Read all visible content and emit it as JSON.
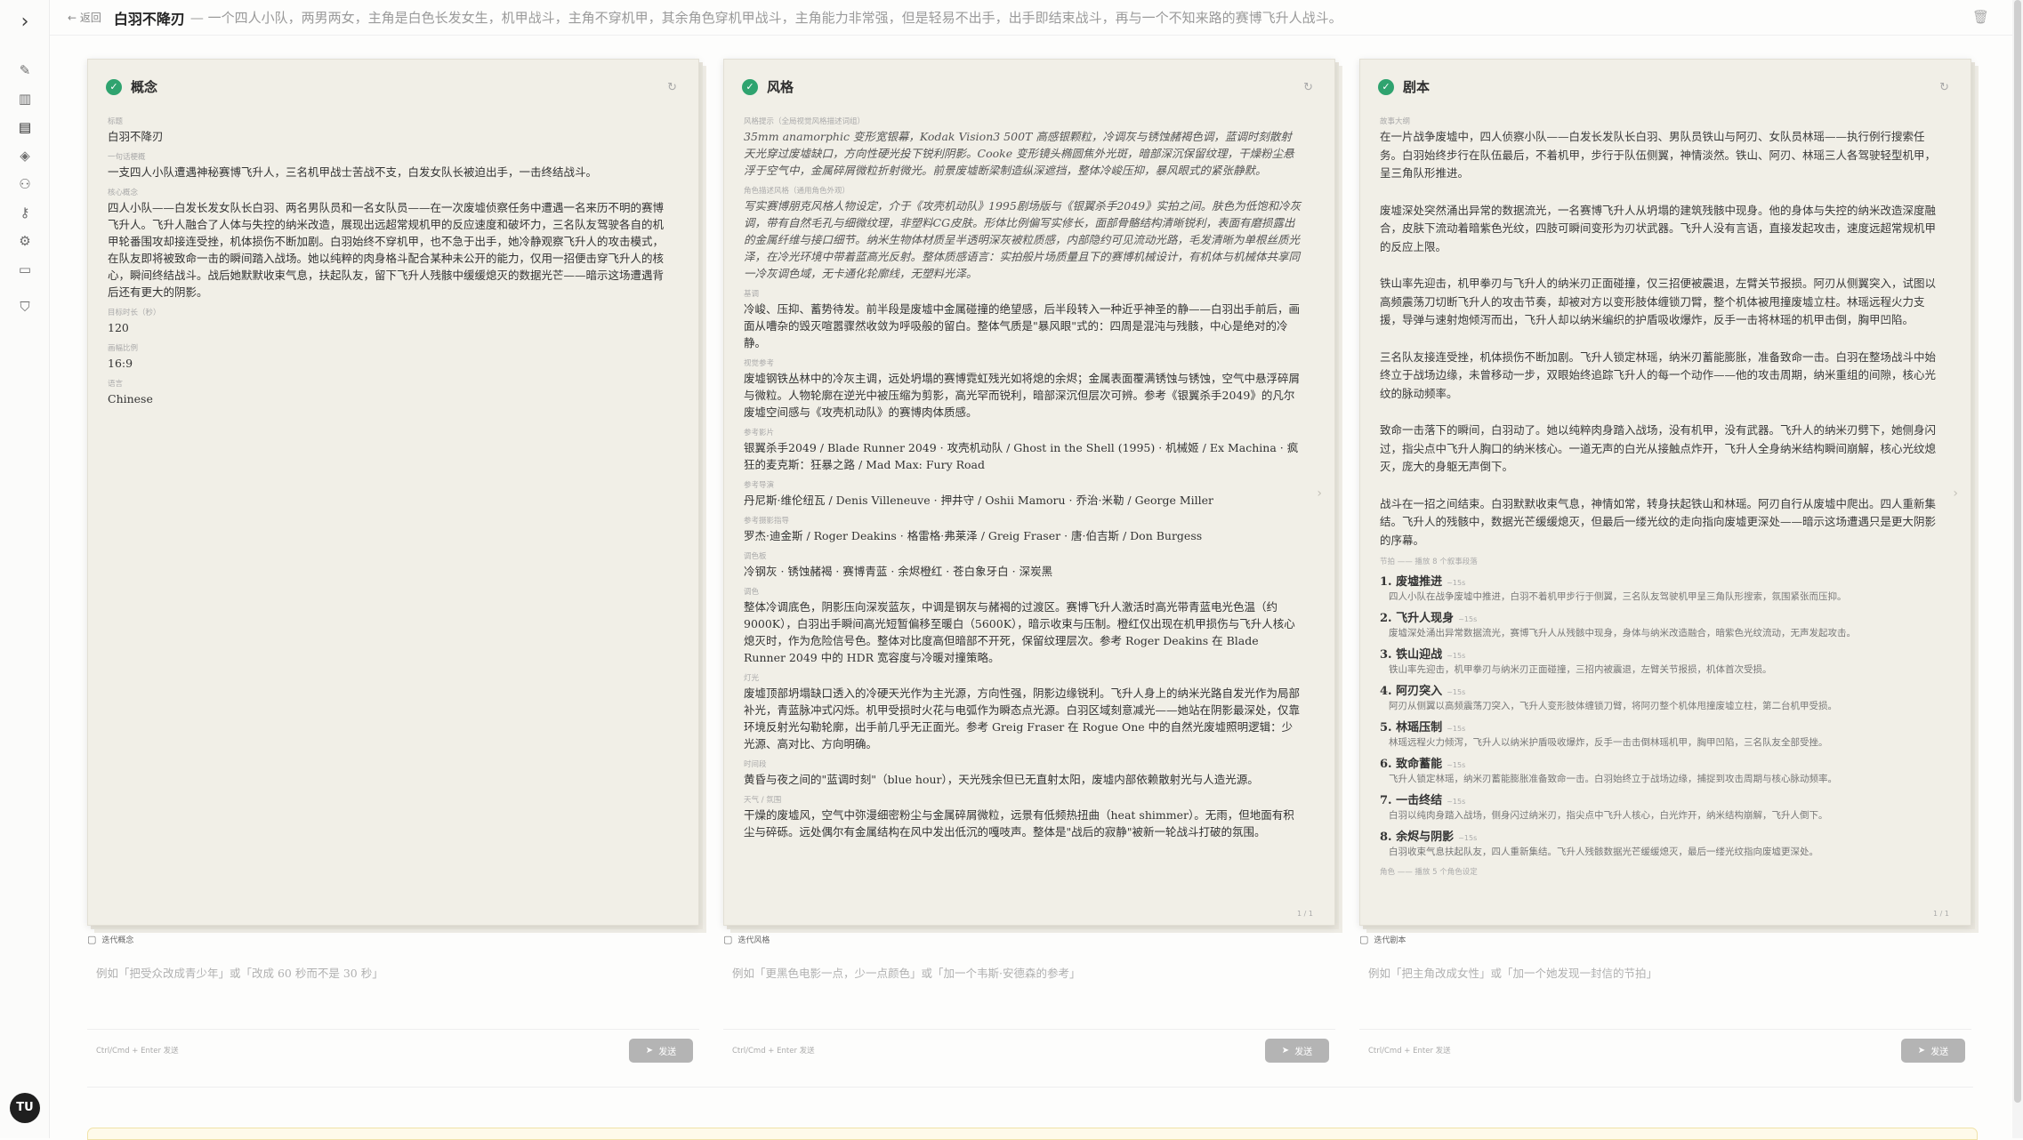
{
  "header": {
    "back_label": "← 返回",
    "title": "白羽不降刃",
    "premise": "— 一个四人小队，两男两女，主角是白色长发女生，机甲战斗，主角不穿机甲，其余角色穿机甲战斗，主角能力非常强，但是轻易不出手，出手即结束战斗，再与一个不知来路的赛博飞升人战斗。"
  },
  "avatar": "TU",
  "cards": {
    "concept": {
      "title": "概念",
      "fields": [
        {
          "label": "标题",
          "value": "白羽不降刃"
        },
        {
          "label": "一句话梗概",
          "value": "一支四人小队遭遇神秘赛博飞升人，三名机甲战士苦战不支，白发女队长被迫出手，一击终结战斗。"
        },
        {
          "label": "核心概念",
          "value": "四人小队——白发长发女队长白羽、两名男队员和一名女队员——在一次废墟侦察任务中遭遇一名来历不明的赛博飞升人。飞升人融合了人体与失控的纳米改造，展现出远超常规机甲的反应速度和破坏力，三名队友驾驶各自的机甲轮番围攻却接连受挫，机体损伤不断加剧。白羽始终不穿机甲，也不急于出手，她冷静观察飞升人的攻击模式，在队友即将被致命一击的瞬间踏入战场。她以纯粹的肉身格斗配合某种未公开的能力，仅用一招便击穿飞升人的核心，瞬间终结战斗。战后她默默收束气息，扶起队友，留下飞升人残骸中缓缓熄灭的数据光芒——暗示这场遭遇背后还有更大的阴影。"
        },
        {
          "label": "目标时长（秒）",
          "value": "120"
        },
        {
          "label": "画幅比例",
          "value": "16:9"
        },
        {
          "label": "语言",
          "value": "Chinese"
        }
      ]
    },
    "style": {
      "title": "风格",
      "fields": [
        {
          "label": "风格提示（全局视觉风格描述词组）",
          "value": "35mm anamorphic 变形宽银幕，Kodak Vision3 500T 高感银颗粒，冷调灰与锈蚀赭褐色调，蓝调时刻散射天光穿过废墟缺口，方向性硬光投下锐利阴影。Cooke 变形镜头椭圆焦外光斑，暗部深沉保留纹理，干燥粉尘悬浮于空气中，金属碎屑微粒折射微光。前景废墟断梁制造纵深遮挡，整体冷峻压抑，暴风眼式的紧张静默。",
          "italic": true
        },
        {
          "label": "角色描述风格（通用角色外观）",
          "value": "写实赛博朋克风格人物设定，介于《攻壳机动队》1995剧场版与《银翼杀手2049》实拍之间。肤色为低饱和冷灰调，带有自然毛孔与细微纹理，非塑料CG皮肤。形体比例偏写实修长，面部骨骼结构清晰锐利，表面有磨损露出的金属纤维与接口细节。纳米生物体材质呈半透明深灰被粒质感，内部隐约可见流动光路，毛发清晰为单根丝质光泽，在冷光环境中带着蓝高光反射。整体质感语言：实拍般片场质量且下的赛博机械设计，有机体与机械体共享同一冷灰调色域，无卡通化轮廓线，无塑料光泽。",
          "italic": true
        },
        {
          "label": "基调",
          "value": "冷峻、压抑、蓄势待发。前半段是废墟中金属碰撞的绝望感，后半段转入一种近乎神圣的静——白羽出手前后，画面从嘈杂的毁灭喧嚣骤然收敛为呼吸般的留白。整体气质是\"暴风眼\"式的：四周是混沌与残骸，中心是绝对的冷静。"
        },
        {
          "label": "视觉参考",
          "value": "废墟钢铁丛林中的冷灰主调，远处坍塌的赛博霓虹残光如将熄的余烬；金属表面覆满锈蚀与锈蚀，空气中悬浮碎屑与微粒。人物轮廓在逆光中被压缩为剪影，高光罕而锐利，暗部深沉但层次可辨。参考《银翼杀手2049》的凡尔废墟空间感与《攻壳机动队》的赛博肉体质感。"
        },
        {
          "label": "参考影片",
          "value": "银翼杀手2049 / Blade Runner 2049 · 攻壳机动队 / Ghost in the Shell (1995) · 机械姬 / Ex Machina · 疯狂的麦克斯：狂暴之路 / Mad Max: Fury Road"
        },
        {
          "label": "参考导演",
          "value": "丹尼斯·维伦纽瓦 / Denis Villeneuve · 押井守 / Oshii Mamoru · 乔治·米勒 / George Miller"
        },
        {
          "label": "参考摄影指导",
          "value": "罗杰·迪金斯 / Roger Deakins · 格雷格·弗莱泽 / Greig Fraser · 唐·伯吉斯 / Don Burgess"
        },
        {
          "label": "调色板",
          "value": "冷钢灰 · 锈蚀赭褐 · 赛博青蓝 · 余烬橙红 · 苍白象牙白 · 深炭黑"
        },
        {
          "label": "调色",
          "value": "整体冷调底色，阴影压向深炭蓝灰，中调是钢灰与赭褐的过渡区。赛博飞升人激活时高光带青蓝电光色温（约9000K），白羽出手瞬间高光短暂偏移至暖白（5600K），暗示收束与压制。橙红仅出现在机甲损伤与飞升人核心熄灭时，作为危险信号色。整体对比度高但暗部不开死，保留纹理层次。参考 Roger Deakins 在 Blade Runner 2049 中的 HDR 宽容度与冷暖对撞策略。"
        },
        {
          "label": "灯光",
          "value": "废墟顶部坍塌缺口透入的冷硬天光作为主光源，方向性强，阴影边缘锐利。飞升人身上的纳米光路自发光作为局部补光，青蓝脉冲式闪烁。机甲受损时火花与电弧作为瞬态点光源。白羽区域刻意减光——她站在阴影最深处，仅靠环境反射光勾勒轮廓，出手前几乎无正面光。参考 Greig Fraser 在 Rogue One 中的自然光废墟照明逻辑：少光源、高对比、方向明确。"
        },
        {
          "label": "时间段",
          "value": "黄昏与夜之间的\"蓝调时刻\"（blue hour），天光残余但已无直射太阳，废墟内部依赖散射光与人造光源。"
        },
        {
          "label": "天气 / 氛围",
          "value": "干燥的废墟风，空气中弥漫细密粉尘与金属碎屑微粒，远景有低频热扭曲（heat shimmer）。无雨，但地面有积尘与碎砾。远处偶尔有金属结构在风中发出低沉的嘎吱声。整体是\"战后的寂静\"被新一轮战斗打破的氛围。"
        }
      ]
    },
    "script": {
      "title": "剧本",
      "label": "故事大纲",
      "paragraphs": [
        "在一片战争废墟中，四人侦察小队——白发长发队长白羽、男队员铁山与阿刃、女队员林瑶——执行例行搜索任务。白羽始终步行在队伍最后，不着机甲，步行于队伍侧翼，神情淡然。铁山、阿刃、林瑶三人各驾驶轻型机甲，呈三角队形推进。",
        "废墟深处突然涌出异常的数据流光，一名赛博飞升人从坍塌的建筑残骸中现身。他的身体与失控的纳米改造深度融合，皮肤下流动着暗紫色光纹，四肢可瞬间变形为刃状武器。飞升人没有言语，直接发起攻击，速度远超常规机甲的反应上限。",
        "铁山率先迎击，机甲拳刃与飞升人的纳米刃正面碰撞，仅三招便被震退，左臂关节报损。阿刃从侧翼突入，试图以高频震荡刀切断飞升人的攻击节奏，却被对方以变形肢体缠锁刀臂，整个机体被甩撞废墟立柱。林瑶远程火力支援，导弹与速射炮倾泻而出，飞升人却以纳米编织的护盾吸收爆炸，反手一击将林瑶的机甲击倒，胸甲凹陷。",
        "三名队友接连受挫，机体损伤不断加剧。飞升人锁定林瑶，纳米刃蓄能膨胀，准备致命一击。白羽在整场战斗中始终立于战场边缘，未曾移动一步，双眼始终追踪飞升人的每一个动作——他的攻击周期，纳米重组的间隙，核心光纹的脉动频率。",
        "致命一击落下的瞬间，白羽动了。她以纯粹肉身踏入战场，没有机甲，没有武器。飞升人的纳米刃劈下，她侧身闪过，指尖点中飞升人胸口的纳米核心。一道无声的白光从接触点炸开，飞升人全身纳米结构瞬间崩解，核心光纹熄灭，庞大的身躯无声倒下。",
        "战斗在一招之间结束。白羽默默收束气息，神情如常，转身扶起铁山和林瑶。阿刃自行从废墟中爬出。四人重新集结。飞升人的残骸中，数据光芒缓缓熄灭，但最后一缕光纹的走向指向废墟更深处——暗示这场遭遇只是更大阴影的序幕。"
      ],
      "beats_label": "节拍 —— 播放 8 个叙事段落",
      "beats": [
        {
          "title": "1. 废墟推进",
          "sec": "~15s",
          "desc": "四人小队在战争废墟中推进，白羽不着机甲步行于侧翼，三名队友驾驶机甲呈三角队形搜索，氛围紧张而压抑。"
        },
        {
          "title": "2. 飞升人现身",
          "sec": "~15s",
          "desc": "废墟深处涌出异常数据流光，赛博飞升人从残骸中现身，身体与纳米改造融合，暗紫色光纹流动，无声发起攻击。"
        },
        {
          "title": "3. 铁山迎战",
          "sec": "~15s",
          "desc": "铁山率先迎击，机甲拳刃与纳米刃正面碰撞，三招内被震退，左臂关节报损，机体首次受损。"
        },
        {
          "title": "4. 阿刃突入",
          "sec": "~15s",
          "desc": "阿刃从侧翼以高频震荡刀突入，飞升人变形肢体缠锁刀臂，将阿刃整个机体甩撞废墟立柱，第二台机甲受损。"
        },
        {
          "title": "5. 林瑶压制",
          "sec": "~15s",
          "desc": "林瑶远程火力倾泻，飞升人以纳米护盾吸收爆炸，反手一击击倒林瑶机甲，胸甲凹陷，三名队友全部受挫。"
        },
        {
          "title": "6. 致命蓄能",
          "sec": "~15s",
          "desc": "飞升人锁定林瑶，纳米刃蓄能膨胀准备致命一击。白羽始终立于战场边缘，捕捉到攻击周期与核心脉动频率。"
        },
        {
          "title": "7. 一击终结",
          "sec": "~15s",
          "desc": "白羽以纯肉身踏入战场，侧身闪过纳米刃，指尖点中飞升人核心，白光炸开，纳米结构崩解，飞升人倒下。"
        },
        {
          "title": "8. 余烬与阴影",
          "sec": "~15s",
          "desc": "白羽收束气息扶起队友，四人重新集结。飞升人残骸数据光芒缓缓熄灭，最后一缕光纹指向废墟更深处。"
        }
      ],
      "footer_label": "角色 —— 播放 5 个角色设定"
    }
  },
  "inputs": [
    {
      "label": "迭代概念",
      "placeholder": "例如「把受众改成青少年」或「改成 60 秒而不是 30 秒」",
      "hint": "Ctrl/Cmd + Enter 发送",
      "send": "发送"
    },
    {
      "label": "迭代风格",
      "placeholder": "例如「更黑色电影一点，少一点颜色」或「加一个韦斯·安德森的参考」",
      "hint": "Ctrl/Cmd + Enter 发送",
      "send": "发送"
    },
    {
      "label": "迭代剧本",
      "placeholder": "例如「把主角改成女性」或「加一个她发现一封信的节拍」",
      "hint": "Ctrl/Cmd + Enter 发送",
      "send": "发送"
    }
  ],
  "page_indicators": [
    "1 / 1",
    "1 / 1"
  ],
  "icons": [
    "expand-icon",
    "wand-icon",
    "chart-icon",
    "folder-icon",
    "layers-icon",
    "users-icon",
    "key-icon",
    "gear-icon",
    "card-icon",
    "shield-icon",
    "trash-icon",
    "refresh-icon",
    "check-icon",
    "chat-icon",
    "send-icon"
  ]
}
